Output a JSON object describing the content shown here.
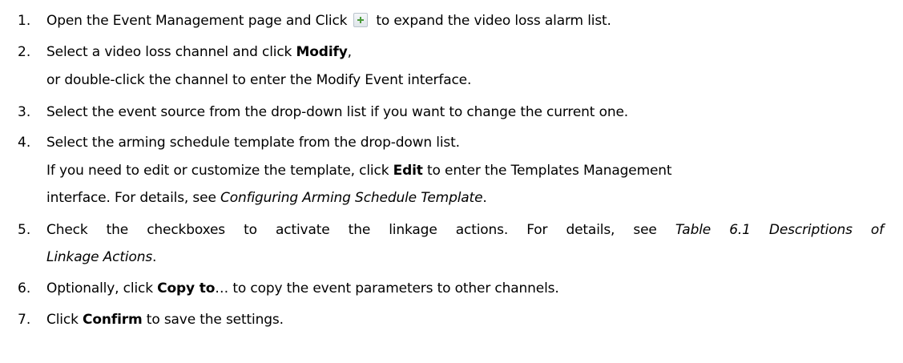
{
  "steps": [
    {
      "number": "1.",
      "before_icon": "Open the Event Management page and Click",
      "icon": "expand-plus-icon",
      "after_icon": "to expand the video loss alarm list."
    },
    {
      "number": "2.",
      "t1": "Select a video loss channel and click ",
      "b1": "Modify",
      "t2": ",",
      "line2": "or double-click the channel to enter the Modify Event interface."
    },
    {
      "number": "3.",
      "text": "Select the event source from the drop-down list if you want to change the current one."
    },
    {
      "number": "4.",
      "text": "Select the arming schedule template from the drop-down list.",
      "l2_t1": "If you need to edit or customize the template, click ",
      "l2_b1": "Edit",
      "l2_t2": " to enter the Templates Management",
      "l3_t1": "interface. For details, see ",
      "l3_i1": "Configuring Arming Schedule Template",
      "l3_t2": "."
    },
    {
      "number": "5.",
      "l1_t1": "Check the checkboxes to activate the linkage actions. For details, see ",
      "l1_i1": "Table 6.1 Descriptions of",
      "l2_i1": "Linkage Actions",
      "l2_t1": "."
    },
    {
      "number": "6.",
      "t1": "Optionally, click ",
      "b1": "Copy to",
      "t2": "… to copy the event parameters to other channels."
    },
    {
      "number": "7.",
      "t1": "Click ",
      "b1": "Confirm",
      "t2": " to save the settings."
    }
  ]
}
